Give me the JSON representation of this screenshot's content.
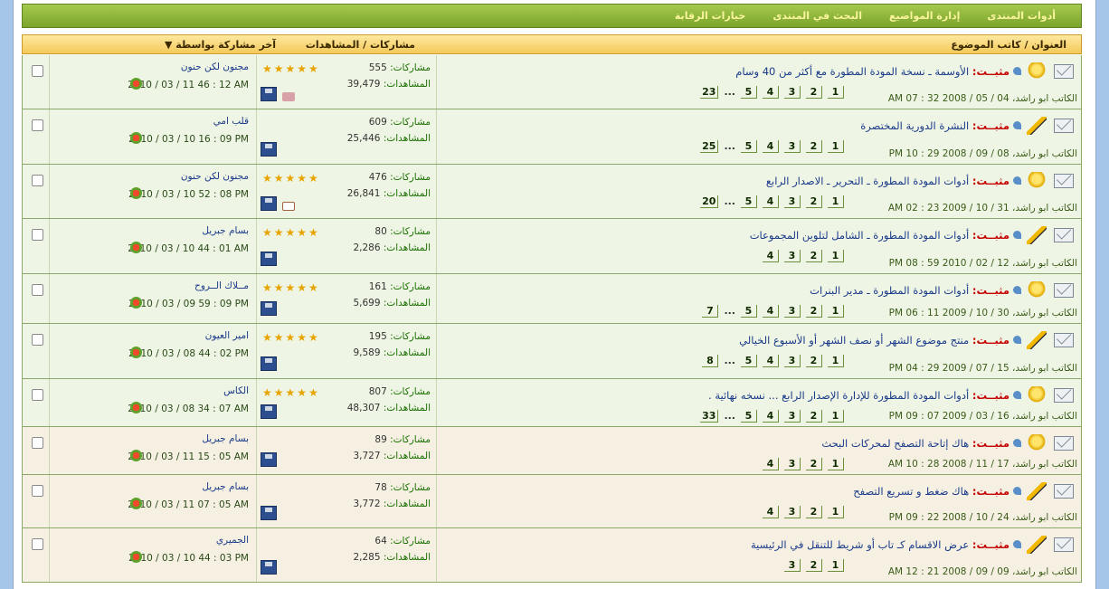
{
  "toolbar": {
    "items": [
      "أدوات المنتدى",
      "إدارة المواضيع",
      "البحث في المنتدى",
      "خيارات الرقابة"
    ]
  },
  "header": {
    "title_col": "العنوان / كاتب الموضوع",
    "stats_col": "مشاركات / المشاهدات",
    "last_col": "آخر مشاركة بواسطة"
  },
  "labels": {
    "posts": "مشاركات:",
    "views": "المشاهدات:",
    "prefix": "مثبــت:",
    "author_prefix": "الكاتب"
  },
  "threads": [
    {
      "icon": "star",
      "title": "الأوسمة ـ نسخة المودة المطورة مع أكثر من 40 وسام",
      "author": "ابو راشد، 04 / 05 / 2008 32 : 07 AM",
      "pages": [
        "1",
        "2",
        "3",
        "4",
        "5",
        "...",
        "23"
      ],
      "posts": "555",
      "views": "39,479",
      "rating": 5,
      "attach": "tag",
      "last_by": "مجنون لكن حنون",
      "last_date": "2010 / 03 / 11   46 : 12 AM"
    },
    {
      "icon": "pen",
      "title": "النشرة الدورية المختصرة",
      "author": "ابو راشد، 08 / 09 / 2008 29 : 10 PM",
      "pages": [
        "1",
        "2",
        "3",
        "4",
        "5",
        "...",
        "25"
      ],
      "posts": "609",
      "views": "25,446",
      "rating": 0,
      "attach": "",
      "last_by": "قلب امي",
      "last_date": "2010 / 03 / 10   16 : 09 PM"
    },
    {
      "icon": "star",
      "title": "أدوات المودة المطورة ـ التحرير ـ الاصدار الرابع",
      "author": "ابو راشد، 31 / 10 / 2009 23 : 02 AM",
      "pages": [
        "1",
        "2",
        "3",
        "4",
        "5",
        "...",
        "20"
      ],
      "posts": "476",
      "views": "26,841",
      "rating": 5,
      "attach": "mail",
      "last_by": "مجنون لكن حنون",
      "last_date": "2010 / 03 / 10   52 : 08 PM"
    },
    {
      "icon": "pen",
      "title": "أدوات المودة المطورة ـ الشامل لتلوين المجموعات",
      "author": "ابو راشد، 12 / 02 / 2010 59 : 08 PM",
      "pages": [
        "1",
        "2",
        "3",
        "4"
      ],
      "posts": "80",
      "views": "2,286",
      "rating": 5,
      "attach": "",
      "last_by": "بسام جبريل",
      "last_date": "2010 / 03 / 10   44 : 01 AM"
    },
    {
      "icon": "star",
      "title": "أدوات المودة المطورة ـ مدير البنرات",
      "author": "ابو راشد، 30 / 10 / 2009 11 : 06 PM",
      "pages": [
        "1",
        "2",
        "3",
        "4",
        "5",
        "...",
        "7"
      ],
      "posts": "161",
      "views": "5,699",
      "rating": 5,
      "attach": "",
      "last_by": "مــلاك الــروح",
      "last_date": "2010 / 03 / 09   59 : 09 PM"
    },
    {
      "icon": "pen",
      "title": "منتج موضوع الشهر أو نصف الشهر أو الأسبوع الخيالي",
      "author": "ابو راشد، 15 / 07 / 2009 29 : 04 PM",
      "pages": [
        "1",
        "2",
        "3",
        "4",
        "5",
        "...",
        "8"
      ],
      "posts": "195",
      "views": "9,589",
      "rating": 5,
      "attach": "",
      "last_by": "امير العيون",
      "last_date": "2010 / 03 / 08   44 : 02 PM"
    },
    {
      "icon": "star",
      "title": "أدوات المودة المطورة للإدارة الإصدار الرابع ... نسخه نهائية .",
      "author": "ابو راشد، 16 / 03 / 2009 07 : 09 PM",
      "pages": [
        "1",
        "2",
        "3",
        "4",
        "5",
        "...",
        "33"
      ],
      "posts": "807",
      "views": "48,307",
      "rating": 5,
      "attach": "",
      "last_by": "الكاس",
      "last_date": "2010 / 03 / 08   34 : 07 AM"
    },
    {
      "icon": "star",
      "title": "هاك إتاحة التصفح لمحركات البحث",
      "author": "ابو راشد، 17 / 11 / 2008 28 : 10 AM",
      "pages": [
        "1",
        "2",
        "3",
        "4"
      ],
      "posts": "89",
      "views": "3,727",
      "rating": 0,
      "attach": "",
      "last_by": "بسام جبريل",
      "last_date": "2010 / 03 / 11   15 : 05 AM"
    },
    {
      "icon": "pen",
      "title": "هاك ضغط و تسريع التصفح",
      "author": "ابو راشد، 24 / 10 / 2008 22 : 09 PM",
      "pages": [
        "1",
        "2",
        "3",
        "4"
      ],
      "posts": "78",
      "views": "3,772",
      "rating": 0,
      "attach": "",
      "last_by": "بسام جبريل",
      "last_date": "2010 / 03 / 11   07 : 05 AM"
    },
    {
      "icon": "pen",
      "title": "عرض الاقسام كـ تاب أو شريط للتنقل في الرئيسية",
      "author": "ابو راشد، 09 / 09 / 2008 21 : 12 AM",
      "pages": [
        "1",
        "2",
        "3"
      ],
      "posts": "64",
      "views": "2,285",
      "rating": 0,
      "attach": "",
      "last_by": "الجميري",
      "last_date": "2010 / 03 / 10   44 : 03 PM"
    }
  ]
}
